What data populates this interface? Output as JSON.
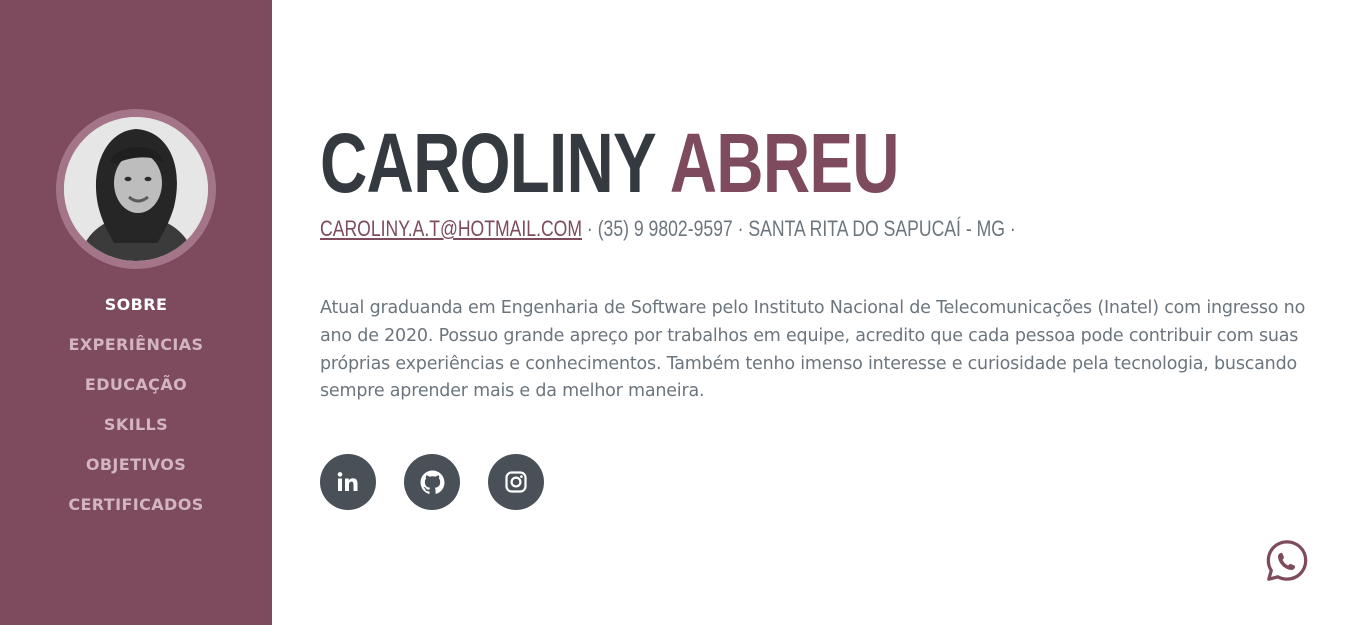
{
  "sidebar": {
    "nav": [
      {
        "label": "SOBRE",
        "active": true
      },
      {
        "label": "EXPERIÊNCIAS",
        "active": false
      },
      {
        "label": "EDUCAÇÃO",
        "active": false
      },
      {
        "label": "SKILLS",
        "active": false
      },
      {
        "label": "OBJETIVOS",
        "active": false
      },
      {
        "label": "CERTIFICADOS",
        "active": false
      }
    ]
  },
  "profile": {
    "first_name": "CAROLINY",
    "last_name": "ABREU",
    "email": "CAROLINY.A.T@HOTMAIL.COM",
    "separator": "·",
    "phone": "(35) 9 9802-9597",
    "location": "SANTA RITA DO SAPUCAÍ - MG",
    "about": "Atual graduanda em Engenharia de Software pelo Instituto Nacional de Telecomunicações (Inatel) com ingresso no ano de 2020. Possuo grande apreço por trabalhos em equipe, acredito que cada pessoa pode contribuir com suas próprias experiências e conhecimentos. Também tenho imenso interesse e curiosidade pela tecnologia, buscando sempre aprender mais e da melhor maneira."
  },
  "socials": [
    {
      "icon": "linkedin-icon"
    },
    {
      "icon": "github-icon"
    },
    {
      "icon": "instagram-icon"
    }
  ],
  "floating": {
    "icon": "whatsapp-icon"
  },
  "colors": {
    "brand": "#7d4a5e",
    "dark_text": "#343a40",
    "muted_text": "#6c757d",
    "social_bg": "#495057"
  }
}
